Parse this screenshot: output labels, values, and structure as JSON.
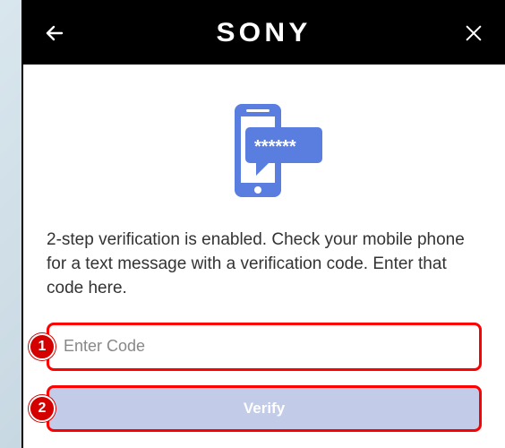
{
  "header": {
    "brand": "SONY",
    "back_icon": "back-arrow",
    "close_icon": "close-x"
  },
  "main": {
    "illustration_icon": "phone-sms-code",
    "instruction": "2-step verification is enabled. Check your mobile phone for a text message with a verification code. Enter that code here.",
    "code_placeholder": "Enter Code",
    "verify_label": "Verify"
  },
  "annotations": {
    "step1": "1",
    "step2": "2"
  },
  "colors": {
    "accent": "#5a7de0",
    "callout": "#d40000",
    "highlight_border": "#ff0000",
    "button_bg": "#c2cbe8"
  }
}
